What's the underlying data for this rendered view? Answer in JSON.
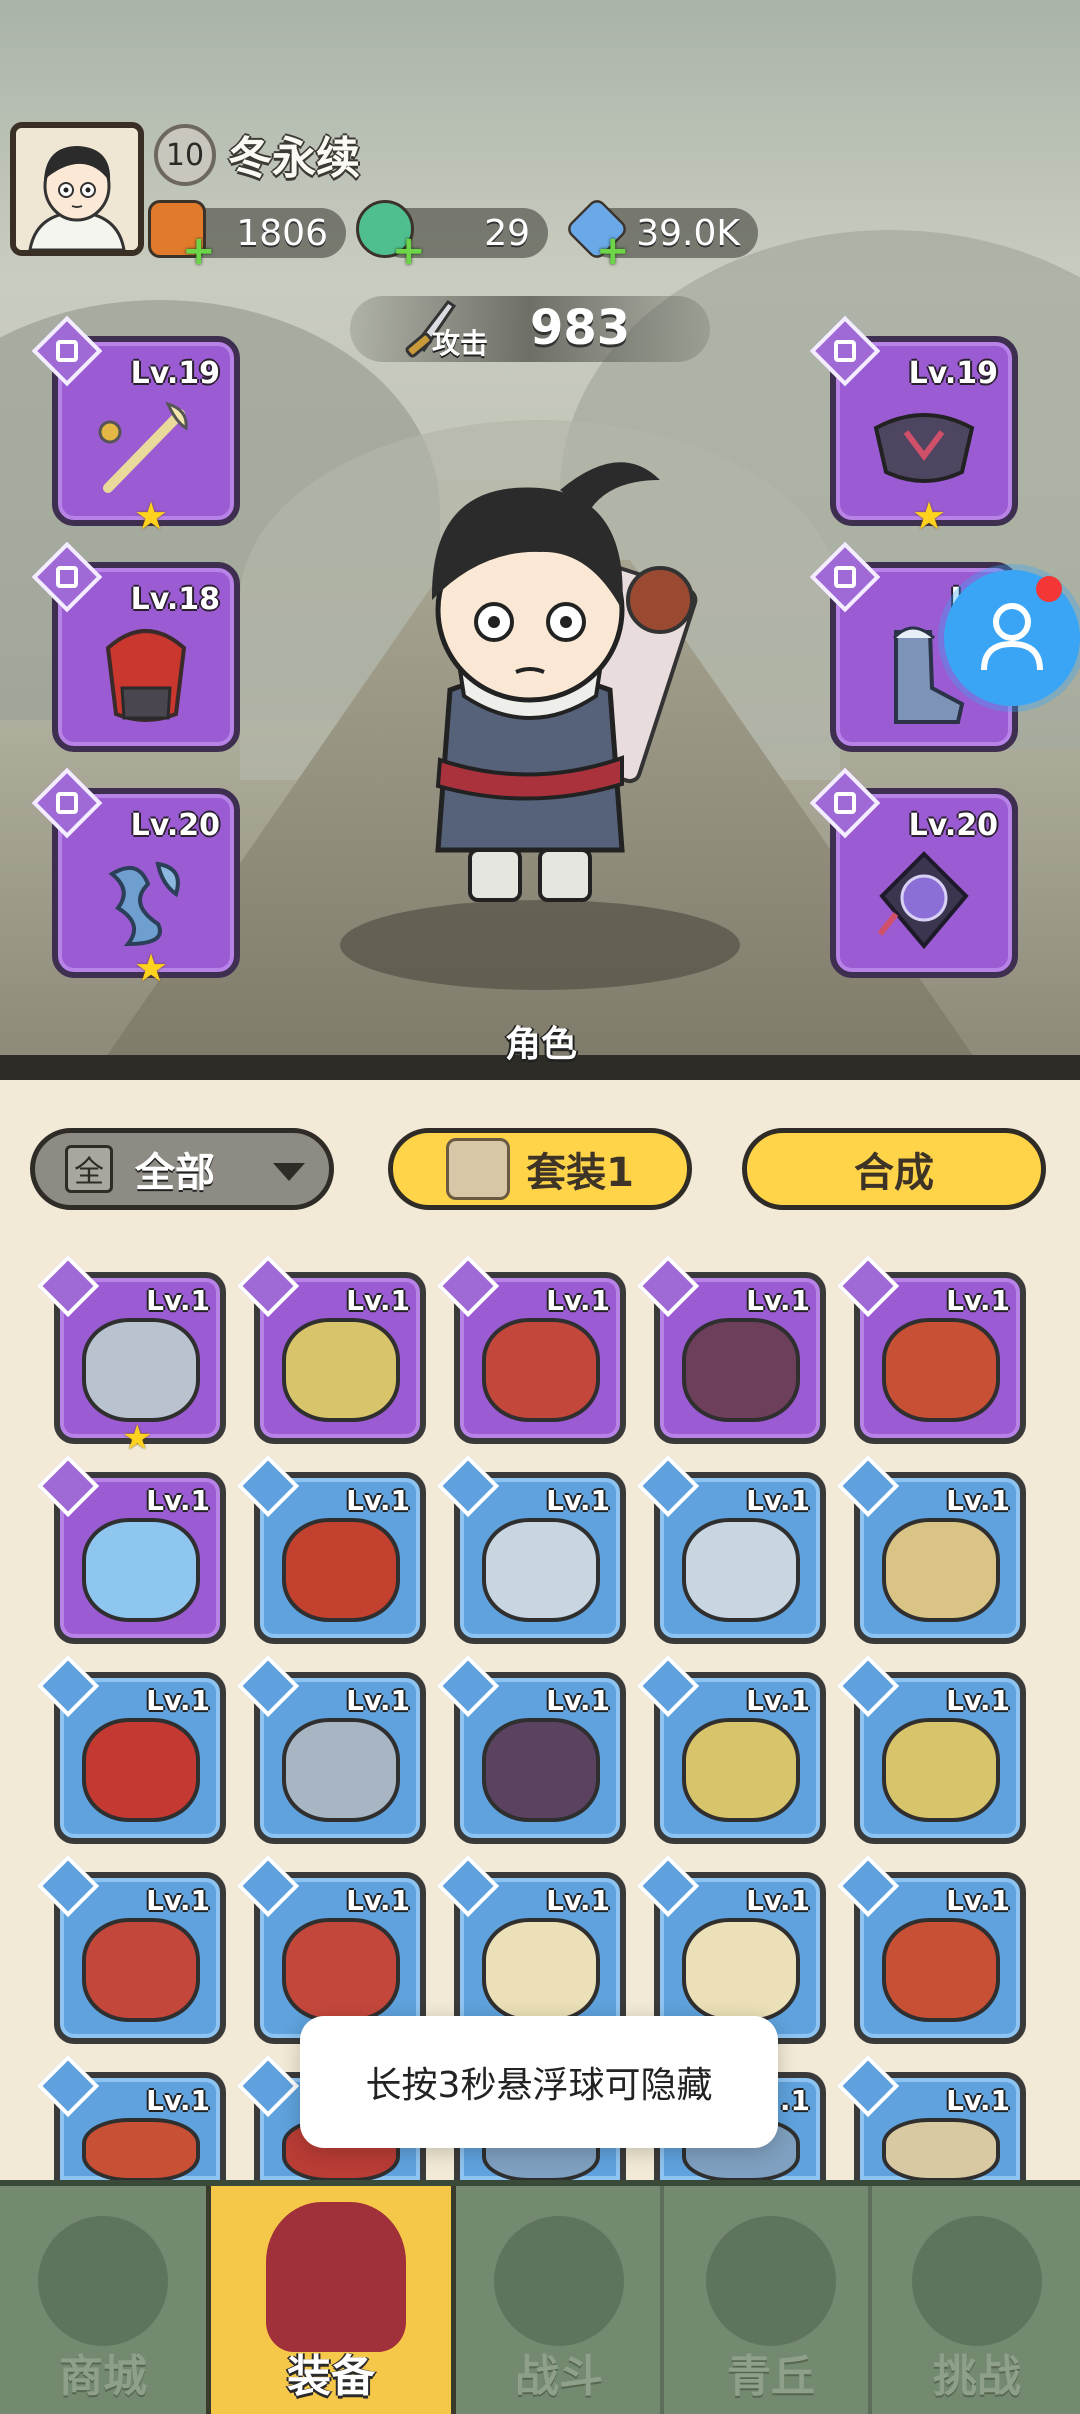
{
  "player": {
    "level": "10",
    "name": "冬永续"
  },
  "resources": [
    {
      "icon": "gift-bag-icon",
      "value": "1806"
    },
    {
      "icon": "jade-dragon-icon",
      "value": "29"
    },
    {
      "icon": "crystal-icon",
      "value": "39.0K"
    }
  ],
  "attack": {
    "label": "攻击",
    "value": "983"
  },
  "equipped_left": [
    {
      "slot": "weapon",
      "icon": "staff-icon",
      "level": "Lv.19",
      "star": "★"
    },
    {
      "slot": "armor",
      "icon": "red-armor-icon",
      "level": "Lv.18",
      "star": ""
    },
    {
      "slot": "ring",
      "icon": "blue-bracer-icon",
      "level": "Lv.20",
      "star": "★"
    }
  ],
  "equipped_right": [
    {
      "slot": "belt",
      "icon": "dark-belt-icon",
      "level": "Lv.19",
      "star": "★"
    },
    {
      "slot": "boots",
      "icon": "boots-icon",
      "level": "Lv.",
      "star": ""
    },
    {
      "slot": "necklace",
      "icon": "amulet-icon",
      "level": "Lv.20",
      "star": ""
    }
  ],
  "role_label": "角色",
  "filter": {
    "icon_char": "全",
    "label": "全部"
  },
  "set_button": "套装1",
  "combine_button": "合成",
  "inventory": [
    {
      "rarity": "p",
      "level": "Lv.1",
      "icon": "silver-belt-icon",
      "star": "★",
      "color": "#b9c3cf"
    },
    {
      "rarity": "p",
      "level": "Lv.1",
      "icon": "gold-armor-icon",
      "star": "",
      "color": "#d8c46a"
    },
    {
      "rarity": "p",
      "level": "Lv.1",
      "icon": "red-bracer-icon",
      "star": "",
      "color": "#c4473c"
    },
    {
      "rarity": "p",
      "level": "Lv.1",
      "icon": "dark-bracer-icon",
      "star": "",
      "color": "#6e3f5a"
    },
    {
      "rarity": "p",
      "level": "Lv.1",
      "icon": "lotus-belt-icon",
      "star": "",
      "color": "#c85034"
    },
    {
      "rarity": "p",
      "level": "Lv.1",
      "icon": "blue-amulet-icon",
      "star": "",
      "color": "#8fc6ef"
    },
    {
      "rarity": "b",
      "level": "Lv.1",
      "icon": "flame-staff-icon",
      "star": "",
      "color": "#c2412f"
    },
    {
      "rarity": "b",
      "level": "Lv.1",
      "icon": "bow-icon",
      "star": "",
      "color": "#c9d6e2"
    },
    {
      "rarity": "b",
      "level": "Lv.1",
      "icon": "bow-icon",
      "star": "",
      "color": "#c9d6e2"
    },
    {
      "rarity": "b",
      "level": "Lv.1",
      "icon": "staff-icon",
      "star": "",
      "color": "#d9c486"
    },
    {
      "rarity": "b",
      "level": "Lv.1",
      "icon": "red-armor-icon",
      "star": "",
      "color": "#c43a32"
    },
    {
      "rarity": "b",
      "level": "Lv.1",
      "icon": "ice-armor-icon",
      "star": "",
      "color": "#a8b6c4"
    },
    {
      "rarity": "b",
      "level": "Lv.1",
      "icon": "dark-armor-icon",
      "star": "",
      "color": "#5b4260"
    },
    {
      "rarity": "b",
      "level": "Lv.1",
      "icon": "gold-armor-icon",
      "star": "",
      "color": "#d8c46a"
    },
    {
      "rarity": "b",
      "level": "Lv.1",
      "icon": "gold-armor-icon",
      "star": "",
      "color": "#d8c46a"
    },
    {
      "rarity": "b",
      "level": "Lv.1",
      "icon": "red-bracer-icon",
      "star": "",
      "color": "#c4473c"
    },
    {
      "rarity": "b",
      "level": "Lv.1",
      "icon": "red-bracer-icon",
      "star": "",
      "color": "#c4473c"
    },
    {
      "rarity": "b",
      "level": "Lv.1",
      "icon": "fur-bracer-icon",
      "star": "",
      "color": "#ece0b8"
    },
    {
      "rarity": "b",
      "level": "Lv.1",
      "icon": "fur-bracer-icon",
      "star": "",
      "color": "#ece0b8"
    },
    {
      "rarity": "b",
      "level": "Lv.1",
      "icon": "lotus-belt-icon",
      "star": "",
      "color": "#c85034"
    },
    {
      "rarity": "b",
      "level": "Lv.1",
      "icon": "lotus-belt-icon",
      "star": "",
      "color": "#c85034"
    },
    {
      "rarity": "b",
      "level": "",
      "icon": "red-helm-icon",
      "star": "",
      "color": "#b93c35"
    },
    {
      "rarity": "b",
      "level": "",
      "icon": "blue-item-icon",
      "star": "",
      "color": "#7fa0c0"
    },
    {
      "rarity": "b",
      "level": ".1",
      "icon": "blue-item-icon",
      "star": "",
      "color": "#7fa0c0"
    },
    {
      "rarity": "b",
      "level": "Lv.1",
      "icon": "fur-boots-icon",
      "star": "",
      "color": "#d8c9a3"
    }
  ],
  "toast": "长按3秒悬浮球可隐藏",
  "nav": [
    {
      "label": "商城",
      "icon": "shop-pavilion-icon"
    },
    {
      "label": "装备",
      "icon": "equipment-helmet-icon"
    },
    {
      "label": "战斗",
      "icon": "crossed-swords-icon"
    },
    {
      "label": "青丘",
      "icon": "mountain-icon"
    },
    {
      "label": "挑战",
      "icon": "challenge-orb-icon"
    }
  ],
  "colors": {
    "purple_tier": "#9b5bd2",
    "blue_tier": "#5fa2dd",
    "button_yellow": "#ffd449",
    "nav_green": "#748a70",
    "nav_active": "#f6c84a"
  }
}
